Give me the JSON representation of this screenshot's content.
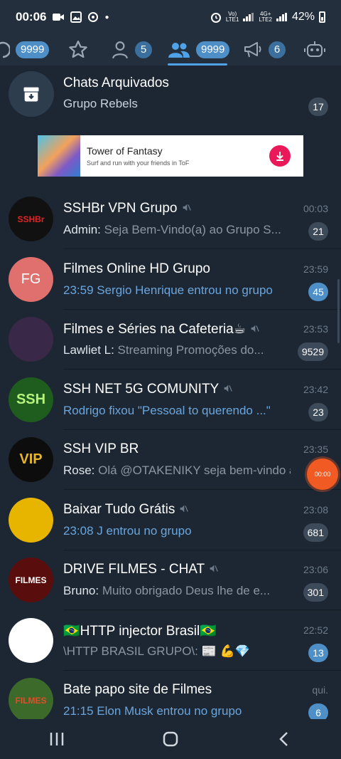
{
  "status": {
    "time": "00:06",
    "battery": "42%",
    "sim1": "LTE1",
    "sim2": "LTE2",
    "net2": "4G+"
  },
  "tabs": [
    {
      "icon": "chat-icon",
      "badge": "9999"
    },
    {
      "icon": "star-icon"
    },
    {
      "icon": "person-icon",
      "badge": "5"
    },
    {
      "icon": "group-icon",
      "badge": "9999",
      "active": true
    },
    {
      "icon": "megaphone-icon",
      "badge": "6"
    },
    {
      "icon": "bot-icon"
    }
  ],
  "archived": {
    "title": "Chats Arquivados",
    "subtitle": "Grupo Rebels",
    "count": "17"
  },
  "ad": {
    "title": "Tower of Fantasy",
    "subtitle": "Surf and run with your friends in ToF"
  },
  "chats": [
    {
      "name": "SSHBr VPN Grupo",
      "muted": true,
      "time": "00:03",
      "sender": "Admin: ",
      "message": "Seja Bem-Vindo(a) ao Grupo S...",
      "count": "21",
      "count_style": "grey",
      "avatar_text": "SSHBr",
      "avatar_bg": "#111111",
      "avatar_fg": "#e02424"
    },
    {
      "name": "Filmes Online HD Grupo",
      "muted": false,
      "time": "23:59",
      "sender": "",
      "message": "23:59 Sergio Henrique entrou no grupo",
      "msg_blue": true,
      "count": "45",
      "count_style": "blue",
      "avatar_text": "FG",
      "avatar_bg": "#e0706d",
      "avatar_fg": "#ffffff"
    },
    {
      "name": "Filmes e Séries na Cafeteria☕",
      "muted": true,
      "time": "23:53",
      "sender": "Lawliet L: ",
      "message": "Streaming Promoções do...",
      "count": "9529",
      "count_style": "grey",
      "avatar_text": "",
      "avatar_bg": "#3a2848",
      "avatar_fg": "#ffffff"
    },
    {
      "name": "SSH NET 5G COMUNITY",
      "muted": true,
      "time": "23:42",
      "sender": "",
      "message": "Rodrigo fixou \"Pessoal to querendo ...\"",
      "msg_blue": true,
      "count": "23",
      "count_style": "grey",
      "avatar_text": "SSH",
      "avatar_bg": "#1f5d1e",
      "avatar_fg": "#b7f27d"
    },
    {
      "name": "SSH VIP BR",
      "muted": false,
      "time": "23:35",
      "sender": "Rose: ",
      "message": "Olá @OTAKENIKY seja bem-vindo a...",
      "count": "",
      "count_style": "grey",
      "avatar_text": "VIP",
      "avatar_bg": "#0d0d0d",
      "avatar_fg": "#e6b52c"
    },
    {
      "name": "Baixar Tudo Grátis",
      "muted": true,
      "time": "23:08",
      "sender": "",
      "message": "23:08 J entrou no grupo",
      "msg_blue": true,
      "count": "681",
      "count_style": "grey",
      "avatar_text": "",
      "avatar_bg": "#e7b400",
      "avatar_fg": "#1d1d1d"
    },
    {
      "name": "DRIVE FILMES - CHAT",
      "muted": true,
      "time": "23:06",
      "sender": "Bruno: ",
      "message": "Muito obrigado Deus lhe de e...",
      "count": "301",
      "count_style": "grey",
      "avatar_text": "FILMES",
      "avatar_bg": "#5a0d0d",
      "avatar_fg": "#ffffff"
    },
    {
      "name": "🇧🇷HTTP injector Brasil🇧🇷",
      "muted": false,
      "time": "22:52",
      "sender": "",
      "message": "\\HTTP BRASIL GRUPO\\: 📰 💪💎",
      "count": "13",
      "count_style": "blue",
      "avatar_text": "",
      "avatar_bg": "#ffffff",
      "avatar_fg": "#23346b"
    },
    {
      "name": "Bate papo site de Filmes",
      "muted": false,
      "time": "qui.",
      "sender": "",
      "message": "21:15 Elon Musk entrou no grupo",
      "msg_blue": true,
      "count": "6",
      "count_style": "blue",
      "avatar_text": "FILMES",
      "avatar_bg": "#3b6a2a",
      "avatar_fg": "#e84b2a"
    }
  ],
  "recorder": {
    "label": "00:00"
  },
  "colors": {
    "accent": "#4e8fc8",
    "background": "#1d2733",
    "bar": "#232f3d"
  }
}
